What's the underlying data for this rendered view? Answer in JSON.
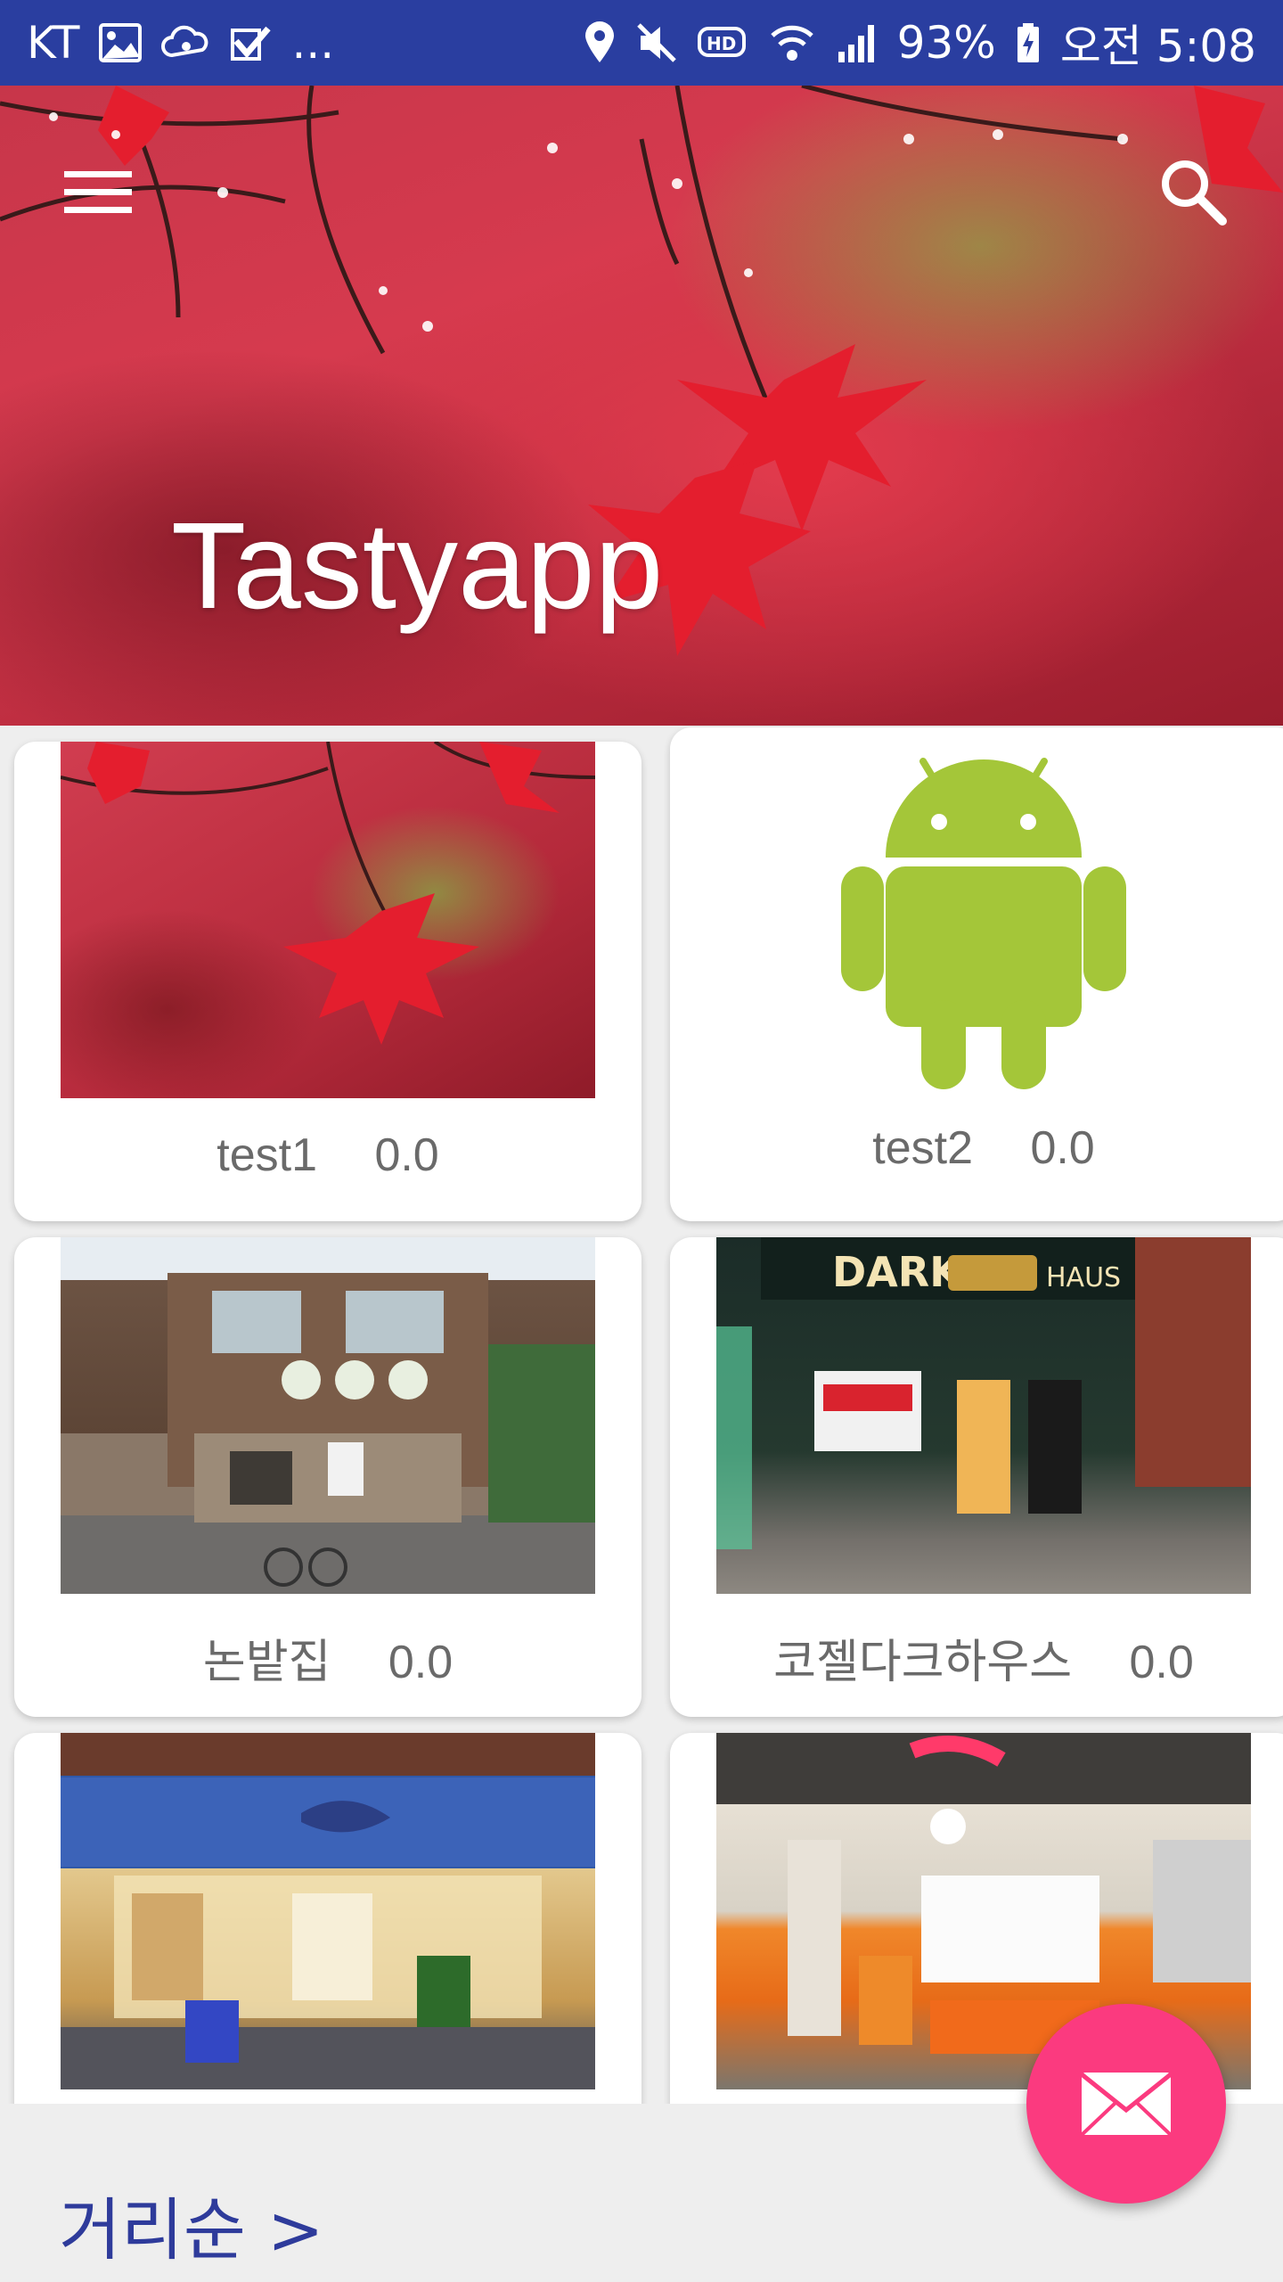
{
  "status_bar": {
    "carrier": "KT",
    "overflow": "...",
    "battery_percent": "93%",
    "time": "오전 5:08",
    "icons_left": [
      "image-icon",
      "cloud-sync-icon",
      "checkbox-icon"
    ],
    "icons_right": [
      "location-icon",
      "mute-icon",
      "hd-icon",
      "wifi-icon",
      "signal-icon",
      "battery-icon"
    ]
  },
  "header": {
    "title": "Tastyapp",
    "menu_icon": "hamburger-menu-icon",
    "search_icon": "search-icon"
  },
  "restaurants": [
    {
      "name": "test1",
      "rating": "0.0",
      "image": "red-maple-leaves"
    },
    {
      "name": "test2",
      "rating": "0.0",
      "image": "android-robot"
    },
    {
      "name": "논밭집",
      "rating": "0.0",
      "image": "storefront-nonbatjip"
    },
    {
      "name": "코젤다크하우스",
      "rating": "0.0",
      "image": "storefront-kozel-dark-haus"
    },
    {
      "name": "",
      "rating": "",
      "image": "storefront-tuna"
    },
    {
      "name": "",
      "rating": "",
      "image": "storefront-modurang"
    }
  ],
  "bottom_bar": {
    "sort_label": "거리순 >"
  },
  "fab": {
    "icon": "mail-icon"
  },
  "colors": {
    "status_bar": "#2a3ea0",
    "accent": "#fb3a7f",
    "sort_label": "#2e3b9b",
    "android_green": "#a4c639"
  }
}
